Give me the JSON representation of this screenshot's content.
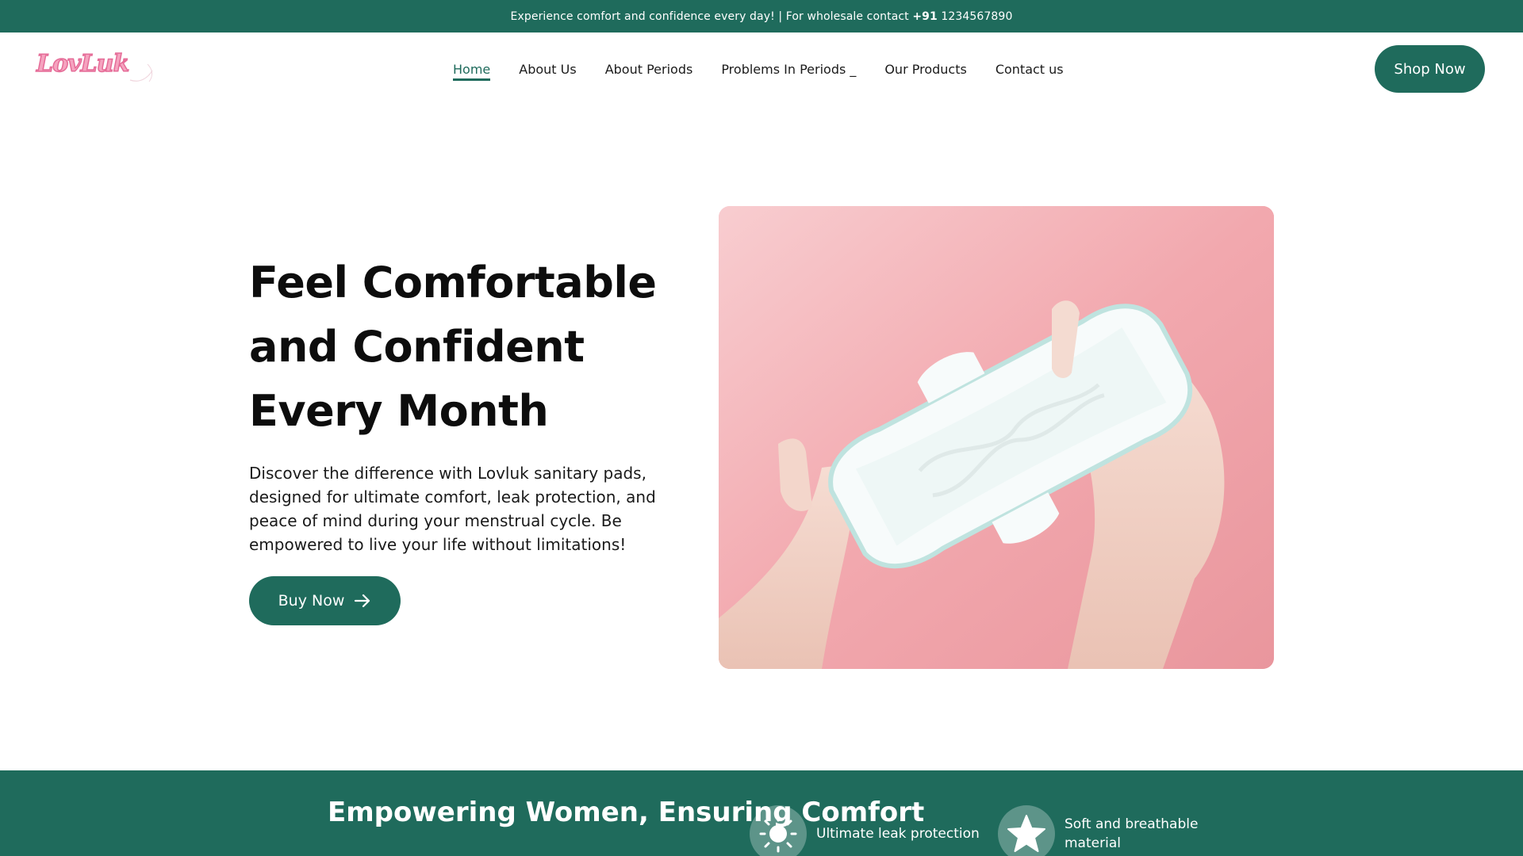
{
  "announcement": {
    "text_before": "Experience comfort and confidence every day! | For wholesale contact ",
    "phone_prefix": "+91",
    "phone_number": " 1234567890"
  },
  "header": {
    "logo_text": "LovLuk",
    "nav": [
      {
        "label": "Home",
        "active": true
      },
      {
        "label": "About Us"
      },
      {
        "label": "About Periods"
      },
      {
        "label": "Problems In Periods"
      },
      {
        "label": "Our Products"
      },
      {
        "label": "Contact us"
      }
    ],
    "dropdown_caret": "_",
    "shop_button": "Shop Now"
  },
  "hero": {
    "title": "Feel Comfortable and Confident Every Month",
    "description": "Discover the difference with Lovluk sanitary pads, designed for ultimate comfort, leak protection, and peace of mind during your menstrual cycle. Be empowered to live your life without limitations!",
    "button_label": "Buy Now",
    "button_icon": "arrow-right-icon"
  },
  "band": {
    "title": "Empowering Women, Ensuring Comfort",
    "features": [
      {
        "icon": "sun-icon",
        "label": "Ultimate leak protection"
      },
      {
        "icon": "star-icon",
        "label": "Soft and breathable material"
      }
    ]
  },
  "colors": {
    "brand_green": "#1f6b5c",
    "logo_pink": "#f5a3bf",
    "image_pink": "#f3aab1"
  }
}
